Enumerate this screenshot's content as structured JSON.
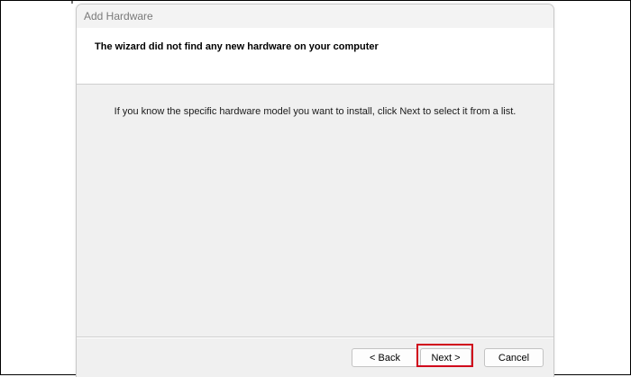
{
  "window": {
    "title": "Add Hardware"
  },
  "header": {
    "title": "The wizard did not find any new hardware on your computer"
  },
  "body": {
    "message": "If you know the specific hardware model you want to install, click Next to select it from a list."
  },
  "buttons": {
    "back": "< Back",
    "next": "Next >",
    "cancel": "Cancel"
  },
  "colors": {
    "highlight": "#d0021b",
    "dialog_background": "#f0f0f0",
    "header_background": "#ffffff"
  }
}
